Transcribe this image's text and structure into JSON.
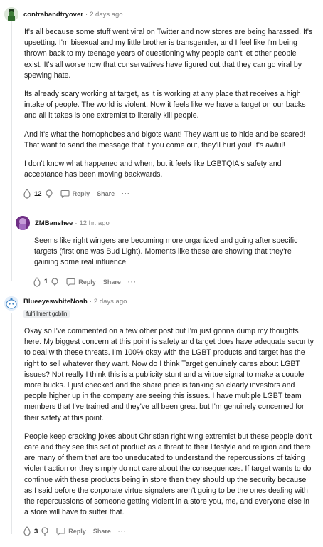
{
  "comments": [
    {
      "author": "contrabandtryover",
      "time": "2 days ago",
      "paragraphs": [
        "It's all because some stuff went viral on Twitter and now stores are being harassed. It's upsetting. I'm bisexual and my little brother is transgender, and I feel like I'm being thrown back to my teenage years of questioning why people can't let other people exist. It's all worse now that conservatives have figured out that they can go viral by spewing hate.",
        "Its already scary working at target, as it is working at any place that receives a high intake of people. The world is violent. Now it feels like we have a target on our backs and all it takes is one extremist to literally kill people.",
        "And it's what the homophobes and bigots want! They want us to hide and be scared! That want to send the message that if you come out, they'll hurt you! It's awful!",
        "I don't know what happened and when, but it feels like LGBTQIA's safety and acceptance has been moving backwards."
      ],
      "score": "12",
      "reply_label": "Reply",
      "share_label": "Share",
      "more_label": "···"
    },
    {
      "author": "ZMBanshee",
      "time": "12 hr. ago",
      "paragraphs": [
        "Seems like right wingers are becoming more organized and going after specific targets (first one was Bud Light). Moments like these are showing that they're gaining some real influence."
      ],
      "score": "1",
      "reply_label": "Reply",
      "share_label": "Share",
      "more_label": "···"
    },
    {
      "author": "BlueeyeswhiteNoah",
      "time": "2 days ago",
      "flair": "fulfillment goblin",
      "paragraphs": [
        "Okay so I've commented on a few other post but I'm just gonna dump my thoughts here. My biggest concern at this point is safety and target does have adequate security to deal with these threats. I'm 100% okay with the LGBT products and target has the right to sell whatever they want. Now do I think Target genuinely cares about LGBT issues? Not really I think this is a publicity stunt and a virtue signal to make a couple more bucks. I just checked and the share price is tanking so clearly investors and people higher up in the company are seeing this issues. I have multiple LGBT team members that I've trained and they've all been great but I'm genuinely concerned for their safety at this point.",
        "People keep cracking jokes about Christian right wing extremist but these people don't care and they see this set of product as a threat to their lifestyle and religion and there are many of them that are too uneducated to understand the repercussions of taking violent action or they simply do not care about the consequences. If target wants to do continue with these products being in store then they should up the security because as I said before the corporate virtue signalers aren't going to be the ones dealing with the repercussions of someone getting violent in a store you, me, and everyone else in a store will have to suffer that."
      ],
      "score": "3",
      "reply_label": "Reply",
      "share_label": "Share",
      "more_label": "···"
    }
  ],
  "colors": {
    "meta": "#7c7c7c",
    "text": "#1c1c1c",
    "thread_line": "#e4e6e8"
  }
}
